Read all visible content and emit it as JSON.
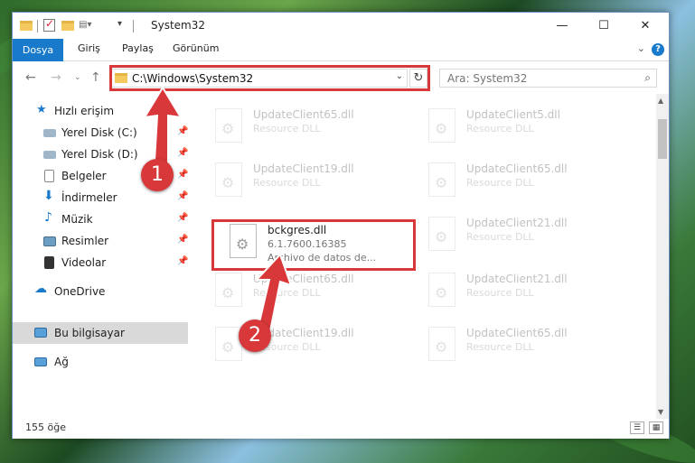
{
  "window": {
    "title": "System32"
  },
  "ribbon": {
    "tabs": [
      "Dosya",
      "Giriş",
      "Paylaş",
      "Görünüm"
    ],
    "help": "?"
  },
  "address": {
    "path": "C:\\Windows\\System32"
  },
  "search": {
    "placeholder": "Ara: System32"
  },
  "sidebar": {
    "items": [
      {
        "label": "Hızlı erişim"
      },
      {
        "label": "Yerel Disk (C:)"
      },
      {
        "label": "Yerel Disk (D:)"
      },
      {
        "label": "Belgeler"
      },
      {
        "label": "İndirmeler"
      },
      {
        "label": "Müzik"
      },
      {
        "label": "Resimler"
      },
      {
        "label": "Videolar"
      },
      {
        "label": "OneDrive"
      },
      {
        "label": "Bu bilgisayar"
      },
      {
        "label": "Ağ"
      }
    ]
  },
  "files": [
    {
      "name": "UpdateClient65.dll",
      "desc": "Resource DLL"
    },
    {
      "name": "UpdateClient5.dll",
      "desc": "Resource DLL"
    },
    {
      "name": "UpdateClient19.dll",
      "desc": "Resource DLL"
    },
    {
      "name": "UpdateClient65.dll",
      "desc": "Resource DLL"
    },
    {
      "name": "bckgres.dll",
      "version": "6.1.7600.16385",
      "desc": "Archivo de datos de..."
    },
    {
      "name": "UpdateClient21.dll",
      "desc": "Resource DLL"
    },
    {
      "name": "UpdateClient65.dll",
      "desc": "Resource DLL"
    },
    {
      "name": "UpdateClient21.dll",
      "desc": "Resource DLL"
    },
    {
      "name": "UpdateClient19.dll",
      "desc": "Resource DLL"
    },
    {
      "name": "UpdateClient65.dll",
      "desc": "Resource DLL"
    }
  ],
  "status": {
    "count": "155 öğe"
  },
  "annotations": {
    "step1": "1",
    "step2": "2"
  },
  "colors": {
    "accent": "#1979ca",
    "highlight": "#d9383a",
    "selected": "#d9d9d9"
  }
}
